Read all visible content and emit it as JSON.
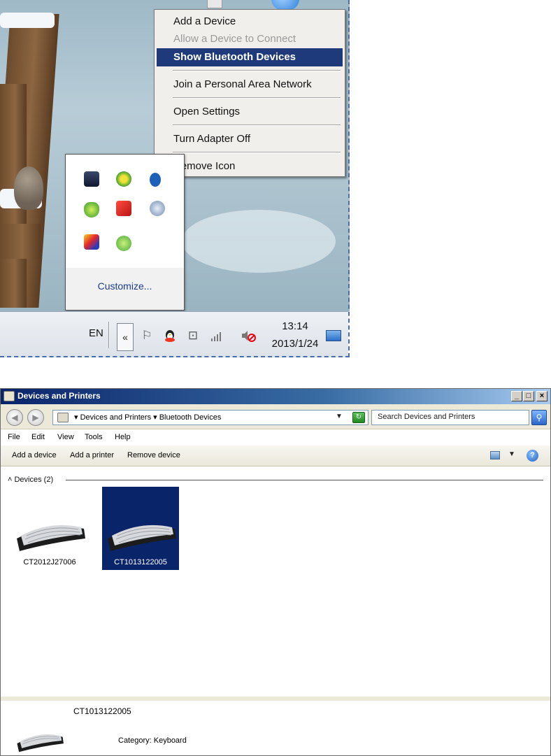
{
  "context_menu": {
    "items": [
      {
        "label": "Add a Device",
        "state": "normal"
      },
      {
        "label": "Allow a Device to Connect",
        "state": "disabled"
      },
      {
        "label": "Show Bluetooth Devices",
        "state": "selected"
      },
      {
        "label": "Join a Personal Area Network",
        "state": "normal"
      },
      {
        "label": "Open Settings",
        "state": "normal"
      },
      {
        "label": "Turn Adapter Off",
        "state": "normal"
      },
      {
        "label": "Remove Icon",
        "state": "normal"
      }
    ]
  },
  "tray_popup": {
    "customize_label": "Customize...",
    "icons": [
      "monitor-icon",
      "plus-icon",
      "bluetooth-icon",
      "shield-icon",
      "tool-icon",
      "magnifier-icon",
      "colorful-app-icon",
      "check-icon"
    ]
  },
  "taskbar": {
    "language": "EN",
    "chevron": "«",
    "time": "13:14",
    "date": "2013/1/24"
  },
  "window": {
    "title": "Devices and Printers",
    "breadcrumb": "▾ Devices and Printers ▾ Bluetooth Devices",
    "search_placeholder": "Search Devices and Printers",
    "menu": [
      "File",
      "Edit",
      "View",
      "Tools",
      "Help"
    ],
    "commands": [
      "Add a device",
      "Add a printer",
      "Remove device"
    ],
    "group_header": "˄ Devices (2)",
    "devices": [
      {
        "name": "CT2012J27006",
        "selected": false
      },
      {
        "name": "CT1013122005",
        "selected": true
      }
    ],
    "details": {
      "name": "CT1013122005",
      "category": "Category: Keyboard"
    }
  },
  "colors": {
    "menu_highlight": "#1f3a7a",
    "title_bar": "#0a246a",
    "selection": "#0a246a"
  }
}
